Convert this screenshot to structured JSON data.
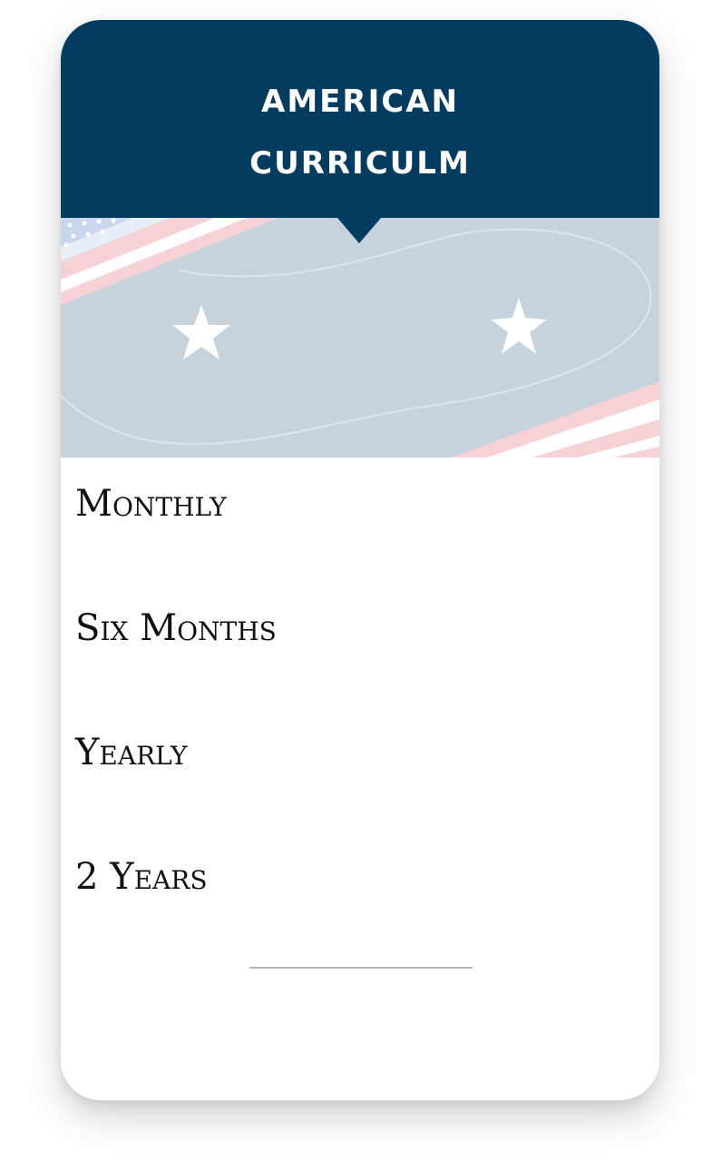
{
  "header": {
    "title_line1": "AMERICAN",
    "title_line2": "CURRICULM",
    "background_color": "#033c5f"
  },
  "banner": {
    "icons": [
      "flag-stars-icon",
      "star-icon",
      "star-icon"
    ],
    "background_color": "#c6d3dc",
    "stripe_color": "#f6d2d6"
  },
  "plans": {
    "items": [
      {
        "label": "Monthly"
      },
      {
        "label": "Six Months"
      },
      {
        "label": "Yearly"
      },
      {
        "label": "2 Years"
      }
    ]
  }
}
